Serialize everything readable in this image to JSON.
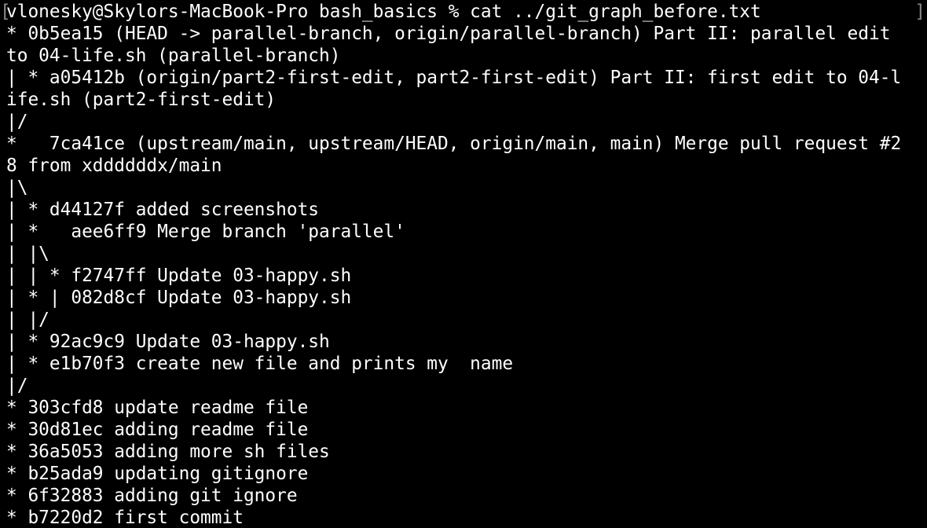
{
  "terminal": {
    "prompt": "vlonesky@Skylors-MacBook-Pro bash_basics % cat ../git_graph_before.txt",
    "open_bracket": "[",
    "close_bracket": "]",
    "lines": [
      "* 0b5ea15 (HEAD -> parallel-branch, origin/parallel-branch) Part II: parallel edit",
      "to 04-life.sh (parallel-branch)",
      "| * a05412b (origin/part2-first-edit, part2-first-edit) Part II: first edit to 04-l",
      "ife.sh (part2-first-edit)",
      "|/",
      "*   7ca41ce (upstream/main, upstream/HEAD, origin/main, main) Merge pull request #2",
      "8 from xddddddx/main",
      "|\\",
      "| * d44127f added screenshots",
      "| *   aee6ff9 Merge branch 'parallel'",
      "| |\\",
      "| | * f2747ff Update 03-happy.sh",
      "| * | 082d8cf Update 03-happy.sh",
      "| |/",
      "| * 92ac9c9 Update 03-happy.sh",
      "| * e1b70f3 create new file and prints my  name",
      "|/",
      "* 303cfd8 update readme file",
      "* 30d81ec adding readme file",
      "* 36a5053 adding more sh files",
      "* b25ada9 updating gitignore",
      "* 6f32883 adding git ignore",
      "* b7220d2 first commit"
    ]
  }
}
